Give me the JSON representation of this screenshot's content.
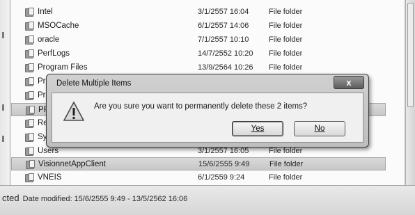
{
  "files": [
    {
      "name": "Intel",
      "date": "3/1/2557 16:04",
      "type": "File folder"
    },
    {
      "name": "MSOCache",
      "date": "6/1/2557 14:06",
      "type": "File folder"
    },
    {
      "name": "oracle",
      "date": "7/1/2557 10:10",
      "type": "File folder"
    },
    {
      "name": "PerfLogs",
      "date": "14/7/2552 10:20",
      "type": "File folder"
    },
    {
      "name": "Program Files",
      "date": "13/9/2564 10:26",
      "type": "File folder"
    },
    {
      "name": "Pro",
      "date": "",
      "type": ""
    },
    {
      "name": "Pro",
      "date": "",
      "type": ""
    },
    {
      "name": "PRO",
      "date": "",
      "type": ""
    },
    {
      "name": "Rec",
      "date": "",
      "type": ""
    },
    {
      "name": "Syst",
      "date": "",
      "type": ""
    },
    {
      "name": "Users",
      "date": "3/1/2557 16:05",
      "type": "File folder"
    },
    {
      "name": "VisionnetAppClient",
      "date": "15/6/2555 9:49",
      "type": "File folder"
    },
    {
      "name": "VNEIS",
      "date": "6/1/2559 9:24",
      "type": "File folder"
    }
  ],
  "details": {
    "selected_suffix": "cted",
    "date_modified": "Date modified: 15/6/2555 9:49 - 13/5/2562 16:06"
  },
  "dialog": {
    "title": "Delete Multiple Items",
    "close_label": "x",
    "message": "Are you sure you want to permanently delete these 2 items?",
    "yes_label": "Yes",
    "no_label": "No"
  }
}
